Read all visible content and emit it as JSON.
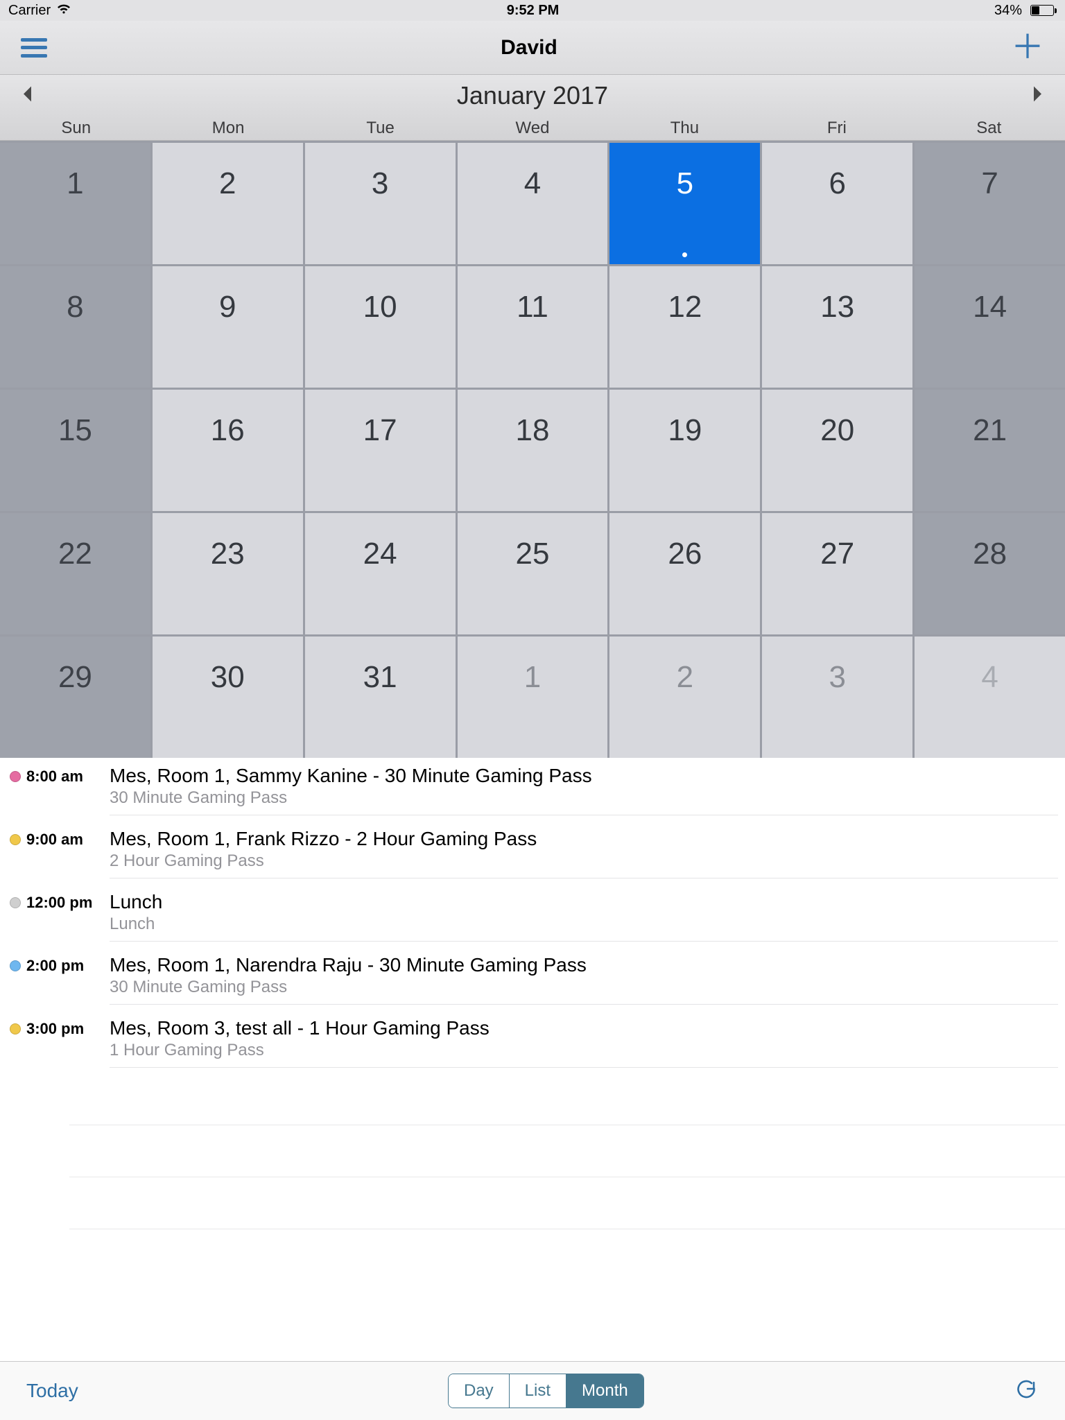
{
  "status": {
    "carrier": "Carrier",
    "time": "9:52 PM",
    "battery": "34%"
  },
  "nav": {
    "title": "David"
  },
  "month_header": {
    "title": "January 2017"
  },
  "dow": [
    "Sun",
    "Mon",
    "Tue",
    "Wed",
    "Thu",
    "Fri",
    "Sat"
  ],
  "days": [
    {
      "n": "1",
      "weekend": true
    },
    {
      "n": "2"
    },
    {
      "n": "3"
    },
    {
      "n": "4"
    },
    {
      "n": "5",
      "sel": true
    },
    {
      "n": "6"
    },
    {
      "n": "7",
      "weekend": true
    },
    {
      "n": "8",
      "weekend": true
    },
    {
      "n": "9"
    },
    {
      "n": "10"
    },
    {
      "n": "11"
    },
    {
      "n": "12"
    },
    {
      "n": "13"
    },
    {
      "n": "14",
      "weekend": true
    },
    {
      "n": "15",
      "weekend": true
    },
    {
      "n": "16"
    },
    {
      "n": "17"
    },
    {
      "n": "18"
    },
    {
      "n": "19"
    },
    {
      "n": "20"
    },
    {
      "n": "21",
      "weekend": true
    },
    {
      "n": "22",
      "weekend": true
    },
    {
      "n": "23"
    },
    {
      "n": "24"
    },
    {
      "n": "25"
    },
    {
      "n": "26"
    },
    {
      "n": "27"
    },
    {
      "n": "28",
      "weekend": true
    },
    {
      "n": "29",
      "weekend": true
    },
    {
      "n": "30"
    },
    {
      "n": "31"
    },
    {
      "n": "1",
      "out": true
    },
    {
      "n": "2",
      "out": true
    },
    {
      "n": "3",
      "out": true
    },
    {
      "n": "4",
      "out": true,
      "weekend": true
    }
  ],
  "events": [
    {
      "time": "8:00 am",
      "color": "#e56ca1",
      "title": "Mes, Room 1, Sammy Kanine - 30 Minute Gaming Pass",
      "sub": "30 Minute Gaming Pass"
    },
    {
      "time": "9:00 am",
      "color": "#f0c84a",
      "title": "Mes, Room 1, Frank Rizzo - 2 Hour Gaming Pass",
      "sub": "2 Hour Gaming Pass"
    },
    {
      "time": "12:00 pm",
      "color": "#cfcfcf",
      "title": "Lunch",
      "sub": "Lunch"
    },
    {
      "time": "2:00 pm",
      "color": "#6fb7ef",
      "title": "Mes, Room 1, Narendra Raju - 30 Minute Gaming Pass",
      "sub": "30 Minute Gaming Pass"
    },
    {
      "time": "3:00 pm",
      "color": "#f0c84a",
      "title": "Mes, Room 3, test all - 1 Hour Gaming Pass",
      "sub": "1 Hour Gaming Pass"
    }
  ],
  "toolbar": {
    "today": "Today",
    "seg": [
      "Day",
      "List",
      "Month"
    ],
    "active": 2
  }
}
